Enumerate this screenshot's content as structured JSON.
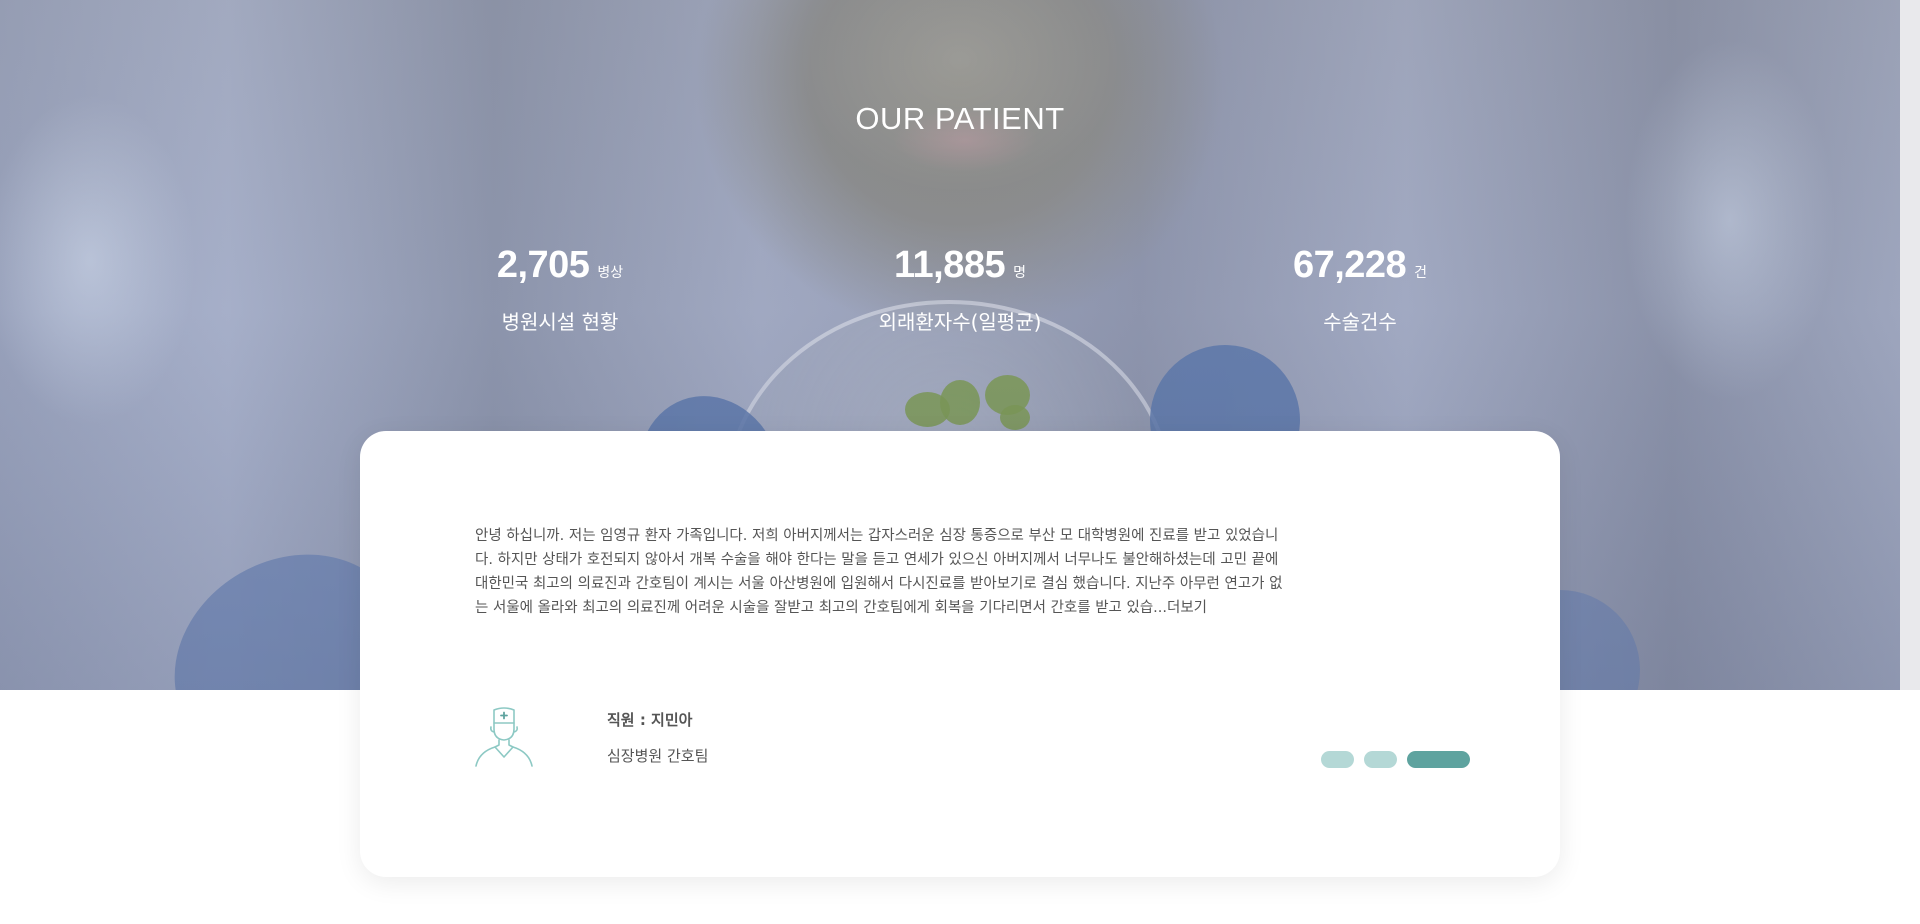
{
  "section": {
    "title": "OUR PATIENT"
  },
  "stats": [
    {
      "value": "2,705",
      "unit": "병상",
      "label": "병원시설 현황"
    },
    {
      "value": "11,885",
      "unit": "명",
      "label": "외래환자수(일평균)"
    },
    {
      "value": "67,228",
      "unit": "건",
      "label": "수술건수"
    }
  ],
  "testimonial": {
    "text": "안녕 하십니까. 저는 임영규 환자 가족입니다. 저희 아버지께서는 갑자스러운 심장 통증으로 부산 모 대학병원에 진료를 받고 있었습니다. 하지만 상태가 호전되지 않아서 개복 수술을 해야 한다는 말을 듣고 연세가 있으신 아버지께서 너무나도 불안해하셨는데 고민 끝에 대한민국 최고의 의료진과 간호팀이 계시는 서울 아산병원에 입원해서 다시진료를 받아보기로 결심 했습니다. 지난주 아무런 연고가 없는 서울에 올라와 최고의 의료진께 어려운 시술을 잘받고 최고의 간호팀에게 회복을 기다리면서 간호를 받고 있습...",
    "more": "더보기",
    "author_name": "직원 : 지민아",
    "author_team": "심장병원 간호팀",
    "avatar_icon": "nurse-icon"
  },
  "pagination": {
    "count": 3,
    "active_index": 2,
    "active_color": "#5ea39f",
    "inactive_color": "#b4d8d6"
  }
}
